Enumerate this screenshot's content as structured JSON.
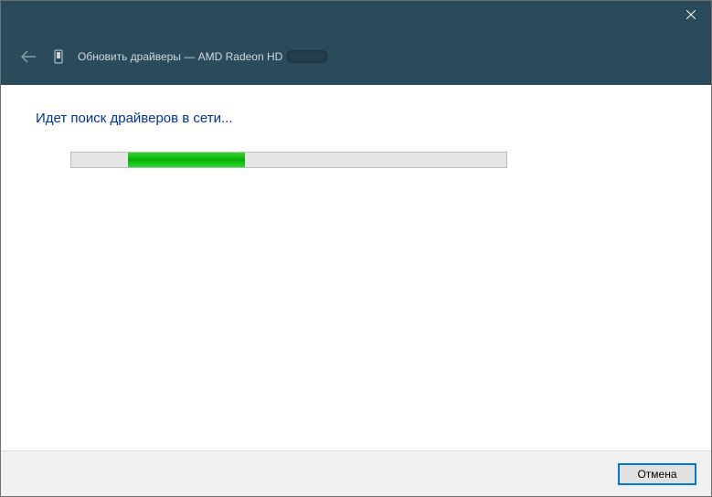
{
  "titlebar": {
    "close_label": "Close"
  },
  "header": {
    "back_label": "Back",
    "title_prefix": "Обновить драйверы — AMD Radeon HD"
  },
  "content": {
    "status": "Идет поиск драйверов в сети..."
  },
  "footer": {
    "cancel_label": "Отмена"
  }
}
